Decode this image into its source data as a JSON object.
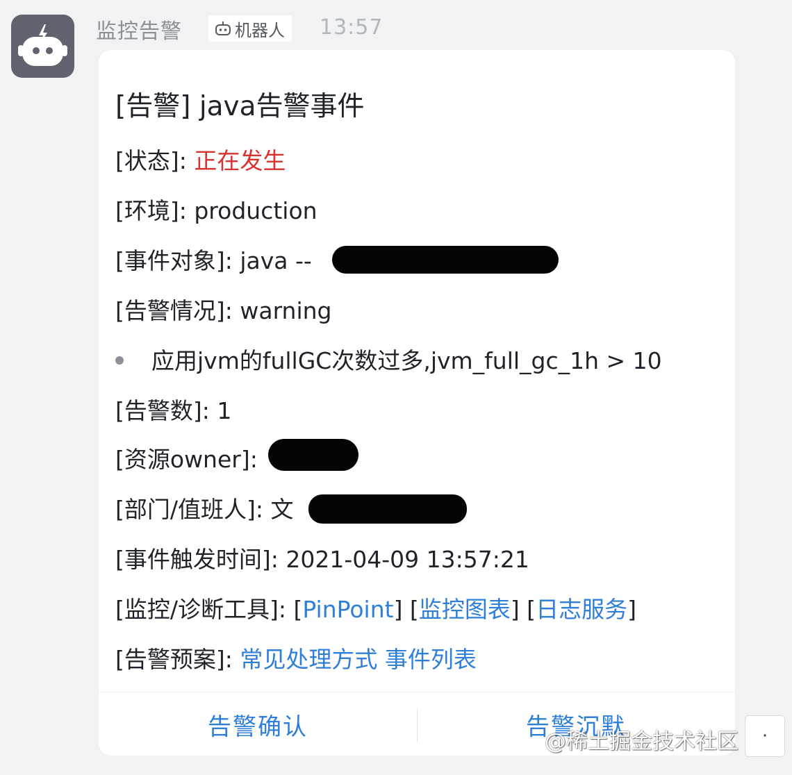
{
  "header": {
    "sender_name": "监控告警",
    "bot_tag_label": "机器人",
    "time": "13:57"
  },
  "card": {
    "title": "[告警] java告警事件",
    "status": {
      "label": "[状态]: ",
      "value": "正在发生",
      "value_color": "#d8322f"
    },
    "environment": {
      "label": "[环境]: ",
      "value": "production"
    },
    "event_object": {
      "label": "[事件对象]: ",
      "value": "java --"
    },
    "alert_level": {
      "label": "[告警情况]: ",
      "value": "warning"
    },
    "bullet_item": "应用jvm的fullGC次数过多,jvm_full_gc_1h > 10",
    "alert_count": {
      "label": "[告警数]: ",
      "value": "1"
    },
    "resource_owner": {
      "label": "[资源owner]: "
    },
    "department": {
      "label": "[部门/值班人]: ",
      "value": "文"
    },
    "trigger_time": {
      "label": "[事件触发时间]: ",
      "value": "2021-04-09 13:57:21"
    },
    "tools": {
      "label": "[监控/诊断工具]: ",
      "links": [
        "PinPoint",
        "监控图表",
        "日志服务"
      ]
    },
    "playbook": {
      "label": "[告警预案]: ",
      "links": [
        "常见处理方式",
        "事件列表"
      ]
    },
    "actions": {
      "confirm": "告警确认",
      "silence": "告警沉默"
    }
  },
  "watermark": "@稀土掘金技术社区",
  "colors": {
    "link": "#2f7fd9",
    "status_red": "#d8322f",
    "avatar_bg": "#5e636d"
  },
  "icons": {
    "avatar": "robot-icon",
    "bot_tag": "robot-icon"
  }
}
